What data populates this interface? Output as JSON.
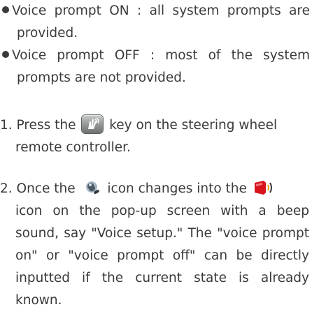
{
  "bullets": [
    {
      "lines": [
        "Voice prompt ON : all system prompts are",
        "provided."
      ]
    },
    {
      "lines": [
        "Voice prompt OFF : most of the system",
        "prompts are not provided."
      ]
    }
  ],
  "step1": {
    "before_icon": "1. Press the ",
    "after_icon": " key on the steering wheel",
    "line2": "remote controller.",
    "icon": "voice-recognition-key-icon"
  },
  "step2": {
    "line1_a": "2. Once the ",
    "line1_b": " icon changes into the ",
    "line2": "icon on the pop-up screen with a beep",
    "line3": "sound, say \"Voice setup.\" The \"voice prompt",
    "line4": "on\" or \"voice prompt off\" can be directly",
    "line5": "inputted if the current state is already",
    "line6": "known.",
    "icons": [
      "microphone-icon",
      "speaking-icon"
    ]
  }
}
